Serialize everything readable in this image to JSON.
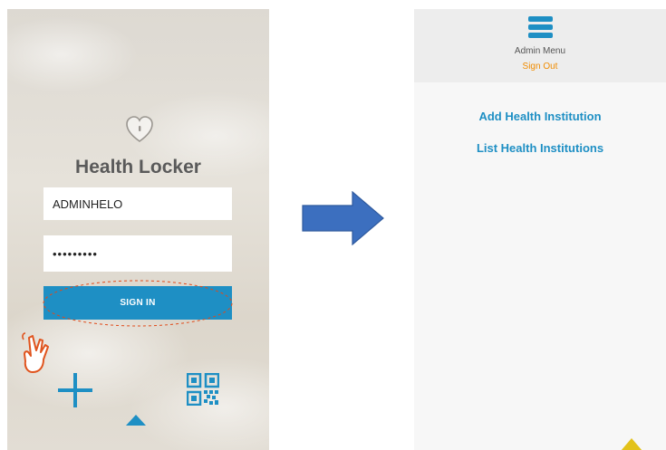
{
  "login_screen": {
    "app_title": "Health Locker",
    "username_value": "ADMINHELO",
    "password_mask": "•••••••••",
    "signin_label": "SIGN IN",
    "icons": [
      "heart-lock-icon",
      "pointing-hand-icon",
      "plus-icon",
      "qr-code-icon",
      "nav-tab-indicator"
    ],
    "accent_color": "#1e8fc4",
    "highlight_color": "#e04a1a"
  },
  "transition": {
    "icon": "right-arrow-icon",
    "color": "#3c6fbf"
  },
  "admin_screen": {
    "menu_title": "Admin Menu",
    "signout_label": "Sign Out",
    "links": [
      "Add Health Institution",
      "List Health Institutions"
    ],
    "icons": [
      "hamburger-menu-icon",
      "corner-indicator-icon"
    ],
    "link_color": "#1e8fc4",
    "signout_color": "#f08c00"
  }
}
